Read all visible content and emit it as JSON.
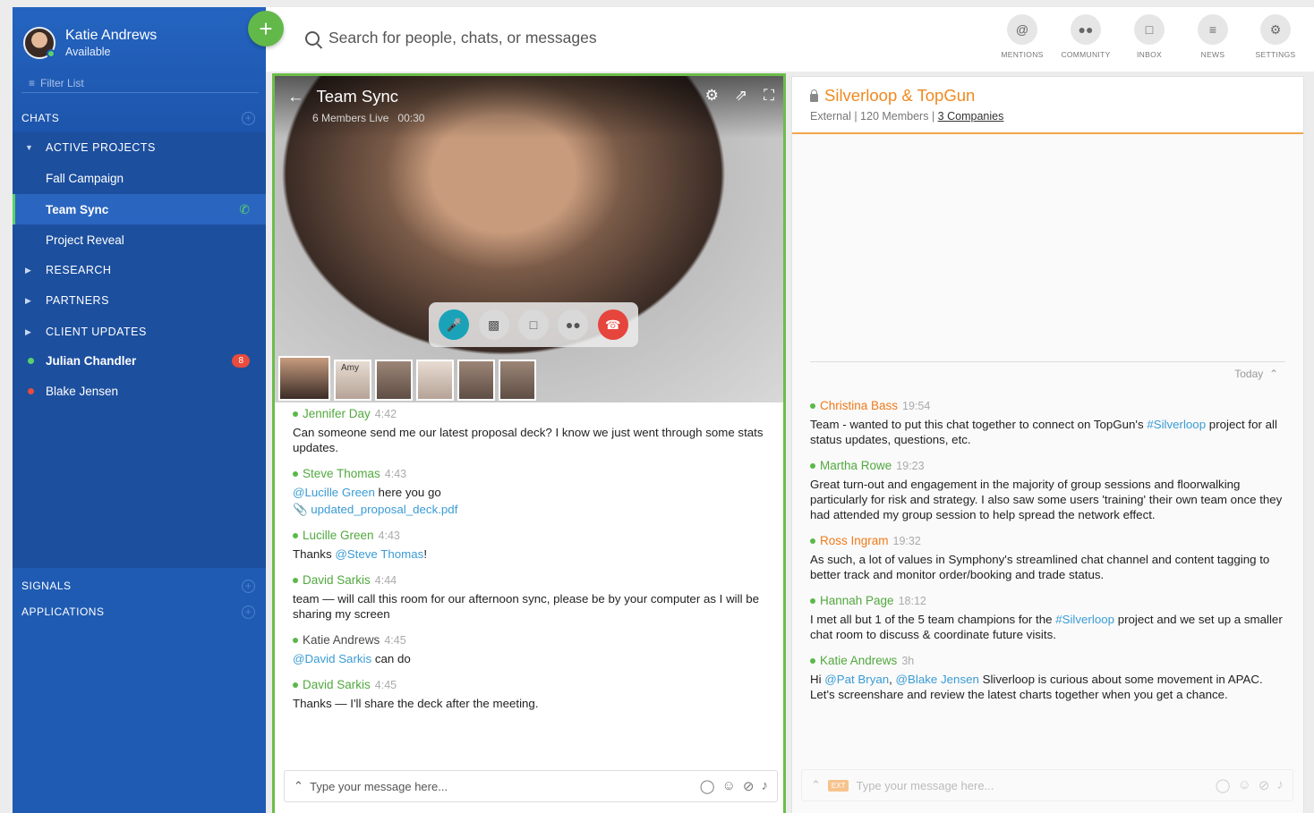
{
  "profile": {
    "name": "Katie Andrews",
    "status": "Available"
  },
  "sidebar": {
    "filter_placeholder": "Filter List",
    "chats_label": "CHATS",
    "items": [
      {
        "label": "ACTIVE PROJECTS",
        "type": "section",
        "expanded": true
      },
      {
        "label": "Fall Campaign",
        "type": "chat"
      },
      {
        "label": "Team Sync",
        "type": "chat",
        "active": true
      },
      {
        "label": "Project Reveal",
        "type": "chat"
      },
      {
        "label": "RESEARCH",
        "type": "section"
      },
      {
        "label": "PARTNERS",
        "type": "section"
      },
      {
        "label": "CLIENT UPDATES",
        "type": "section"
      },
      {
        "label": "Julian Chandler",
        "type": "person",
        "presence": "#5bd16b",
        "badge": "8"
      },
      {
        "label": "Blake Jensen",
        "type": "person",
        "presence": "#e74c3c"
      }
    ],
    "signals_label": "SIGNALS",
    "applications_label": "APPLICATIONS"
  },
  "search": {
    "placeholder": "Search for people, chats, or messages"
  },
  "nav": [
    {
      "label": "MENTIONS",
      "icon": "at-icon"
    },
    {
      "label": "COMMUNITY",
      "icon": "community-icon"
    },
    {
      "label": "INBOX",
      "icon": "inbox-icon"
    },
    {
      "label": "NEWS",
      "icon": "news-icon"
    },
    {
      "label": "SETTINGS",
      "icon": "gear-icon"
    }
  ],
  "video": {
    "title": "Team Sync",
    "members": "6 Members Live",
    "duration": "00:30",
    "thumb_name": "Amy"
  },
  "left_messages": [
    {
      "author": "Jennifer Day",
      "time": "4:42",
      "text": "Can someone send me our latest proposal deck? I know we just went through some stats updates."
    },
    {
      "author": "Steve Thomas",
      "time": "4:43",
      "mention": "@Lucille Green",
      "text": " here you go",
      "attachment": "updated_proposal_deck.pdf"
    },
    {
      "author": "Lucille Green",
      "time": "4:43",
      "prefix": "Thanks ",
      "mention": "@Steve Thomas",
      "text": "!"
    },
    {
      "author": "David Sarkis",
      "time": "4:44",
      "text": "team — will call this room for our afternoon sync, please be by your computer as I will be sharing my screen"
    },
    {
      "author": "Katie Andrews",
      "time": "4:45",
      "mention": "@David Sarkis",
      "text": " can do"
    },
    {
      "author": "David Sarkis",
      "time": "4:45",
      "text": "Thanks — I'll share the deck after the meeting."
    }
  ],
  "left_compose_placeholder": "Type your message here...",
  "right": {
    "title": "Silverloop & TopGun",
    "sub_prefix": "External | 120 Members | ",
    "companies_link": "3 Companies",
    "today": "Today",
    "ext_tag": "EXT",
    "compose_placeholder": "Type your message here..."
  },
  "right_messages": [
    {
      "author": "Christina Bass",
      "time": "19:54",
      "text1": "Team - wanted to put this chat together to connect on TopGun's ",
      "tag": "#Silverloop",
      "text2": " project for all status updates, questions, etc."
    },
    {
      "author": "Martha Rowe",
      "time": "19:23",
      "text1": "Great turn-out and engagement in the majority of group sessions and floorwalking particularly for risk and strategy. I also saw some users 'training' their own team once they had attended my group session to help spread the network effect."
    },
    {
      "author": "Ross Ingram",
      "time": "19:32",
      "text1": "As such, a lot of values in Symphony's streamlined chat channel and content tagging to better track and monitor order/booking and trade status."
    },
    {
      "author": "Hannah Page",
      "time": "18:12",
      "text1": "I met all but 1 of the 5 team champions for the ",
      "tag": "#Silverloop",
      "text2": " project and we set up a smaller chat room to discuss & coordinate future visits."
    },
    {
      "author": "Katie Andrews",
      "time": "3h",
      "text1": "Hi ",
      "tag": "@Pat Bryan",
      "text_mid": ", ",
      "tag2": "@Blake Jensen",
      "text2": " Sliverloop is curious about some movement in APAC. Let's screenshare and review the latest charts together when you get a chance."
    }
  ]
}
